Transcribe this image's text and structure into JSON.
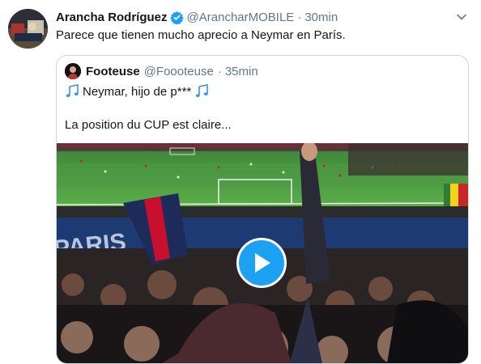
{
  "tweet": {
    "author_name": "Arancha Rodríguez",
    "author_handle": "@ArancharMOBILE",
    "separator": "·",
    "timestamp": "30min",
    "text": "Parece que tienen mucho aprecio a Neymar en París."
  },
  "quoted_tweet": {
    "author_name": "Footeuse",
    "author_handle": "@Foooteuse",
    "separator": "·",
    "timestamp": "35min",
    "line1": "Neymar, hijo de p***",
    "line2": "La position du CUP est claire..."
  },
  "media": {
    "type": "video",
    "stadium_banner_text": "PARIS"
  },
  "colors": {
    "accent": "#1da1f2",
    "secondary_text": "#657786",
    "border": "#ccd6dd"
  },
  "icons": {
    "verified": "verified-badge-icon",
    "caret": "chevron-down-icon",
    "music_note": "music-notes-icon",
    "play": "play-icon"
  }
}
